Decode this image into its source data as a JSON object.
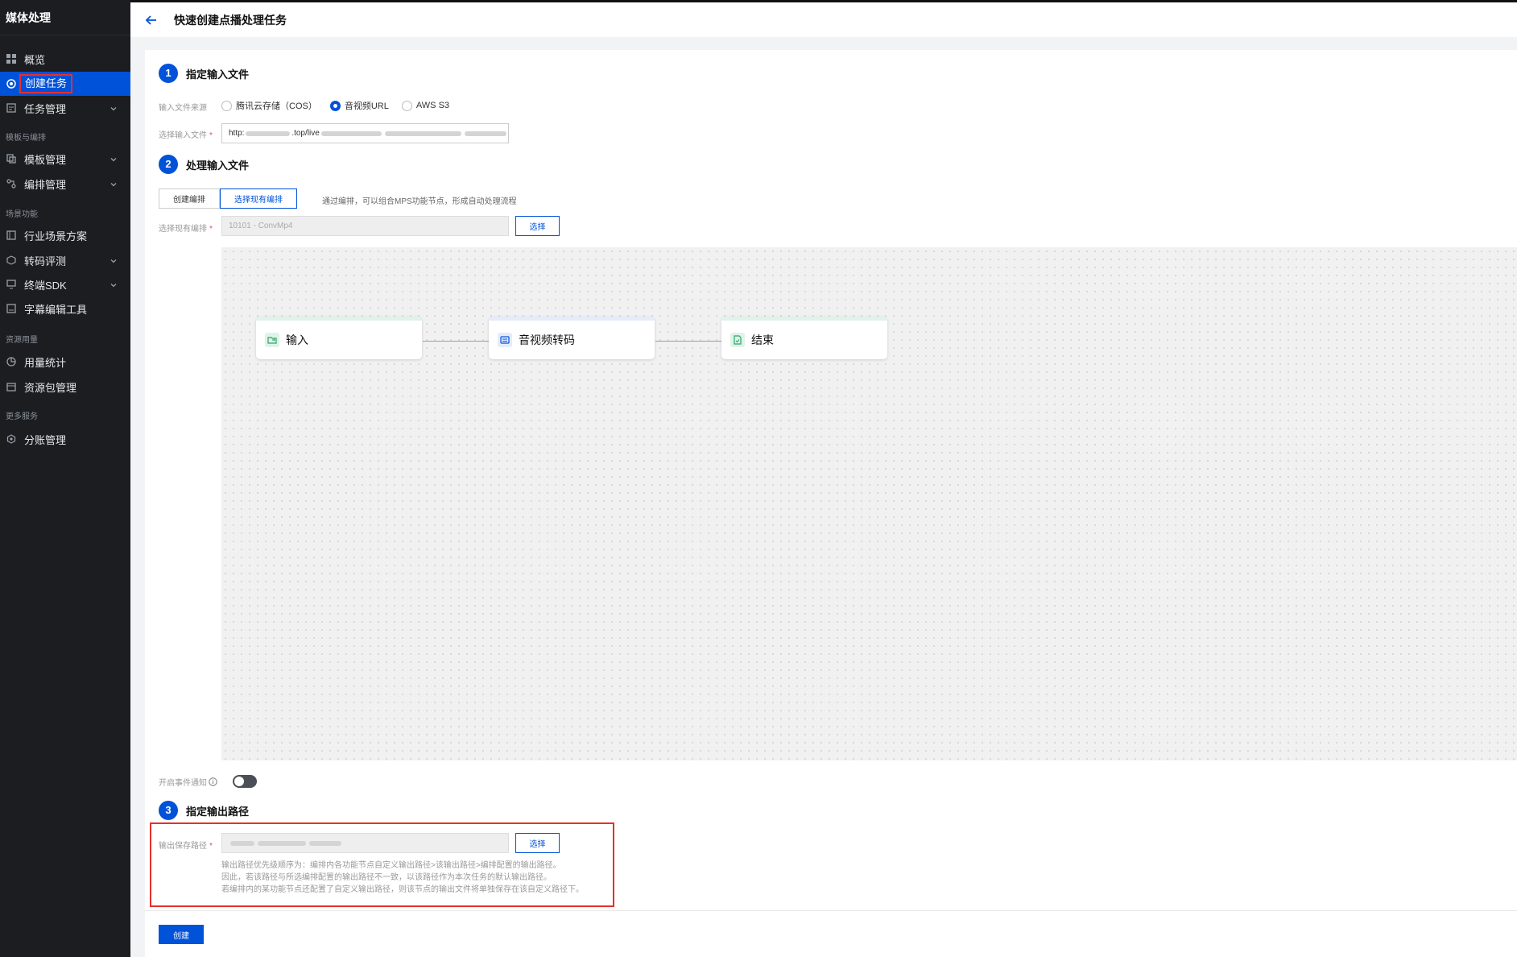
{
  "sidebar": {
    "app_title": "媒体处理",
    "items": {
      "overview": "概览",
      "create_task": "创建任务",
      "task_mgmt": "任务管理",
      "template_mgmt": "模板管理",
      "orchestration_mgmt": "编排管理",
      "industry_solution": "行业场景方案",
      "transcode_eval": "转码评测",
      "terminal_sdk": "终端SDK",
      "subtitle_tool": "字幕编辑工具",
      "usage_stats": "用量统计",
      "package_mgmt": "资源包管理",
      "split_billing": "分账管理"
    },
    "groups": {
      "templates": "模板与编排",
      "scenarios": "场景功能",
      "resources": "资源用量",
      "more": "更多服务"
    }
  },
  "header": {
    "title": "快速创建点播处理任务"
  },
  "step1": {
    "num": "1",
    "title": "指定输入文件",
    "source_label": "输入文件来源",
    "sources": {
      "cos": "腾讯云存储（COS）",
      "url": "音视频URL",
      "aws": "AWS S3"
    },
    "file_label": "选择输入文件",
    "file_value_prefix": "http:",
    "file_value_mid": ".top/live"
  },
  "step2": {
    "num": "2",
    "title": "处理输入文件",
    "tabs": {
      "create": "创建编排",
      "existing": "选择现有编排"
    },
    "hint": "通过编排，可以组合MPS功能节点，形成自动处理流程",
    "orch_label": "选择现有编排",
    "orch_value": "10101 - ConvMp4",
    "select_btn": "选择",
    "nodes": {
      "input": "输入",
      "transcode": "音视频转码",
      "end": "结束"
    },
    "event_label": "开启事件通知"
  },
  "step3": {
    "num": "3",
    "title": "指定输出路径",
    "path_label": "输出保存路径",
    "select_btn": "选择",
    "notes": [
      "输出路径优先级顺序为：编排内各功能节点自定义输出路径>该输出路径>编排配置的输出路径。",
      "因此，若该路径与所选编排配置的输出路径不一致，以该路径作为本次任务的默认输出路径。",
      "若编排内的某功能节点还配置了自定义输出路径，则该节点的输出文件将单独保存在该自定义路径下。"
    ]
  },
  "footer": {
    "create_btn": "创建"
  },
  "colors": {
    "accent": "#0052d9",
    "highlight": "#e5302b",
    "sidebar_bg": "#1b1d21"
  }
}
